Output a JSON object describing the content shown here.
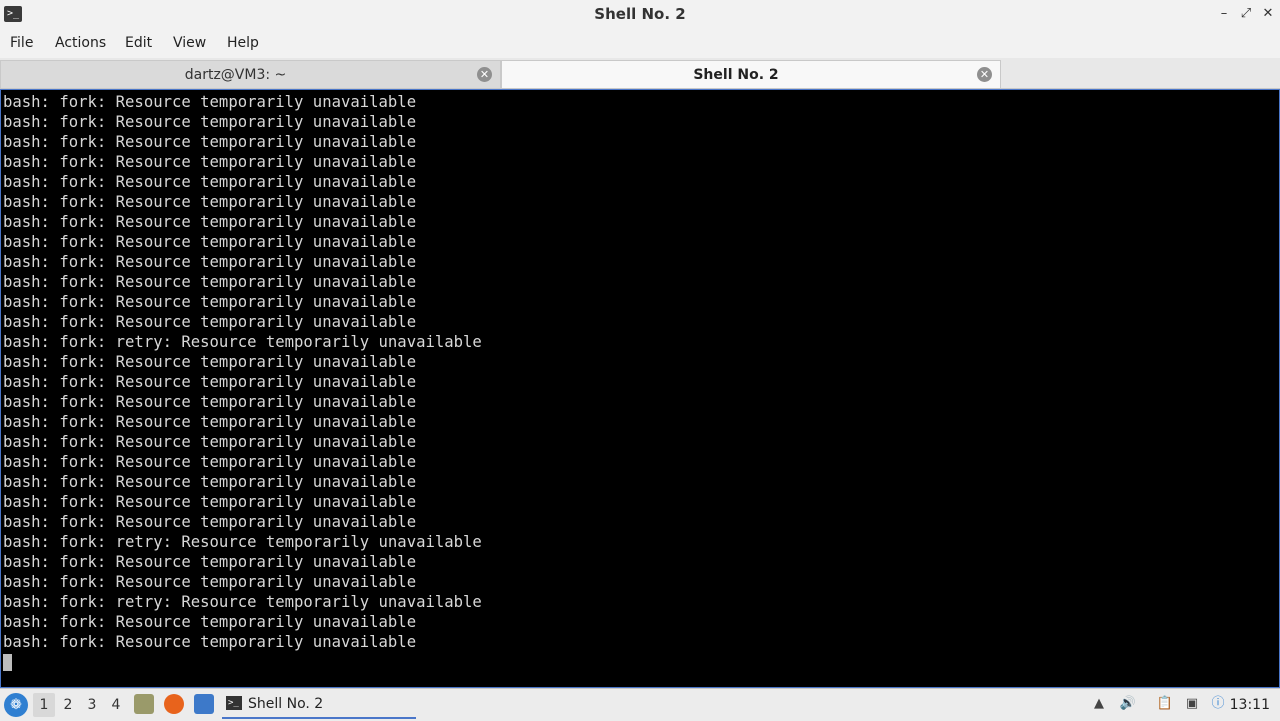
{
  "window": {
    "title": "Shell No. 2",
    "app_icon": "terminal-icon",
    "buttons": {
      "minimize": "minimize-icon",
      "maximize": "maximize-icon",
      "close": "close-icon"
    }
  },
  "menu": [
    "File",
    "Actions",
    "Edit",
    "View",
    "Help"
  ],
  "tabs": [
    {
      "label": "dartz@VM3: ~",
      "active": false
    },
    {
      "label": "Shell No. 2",
      "active": true
    }
  ],
  "terminal": {
    "lines": [
      "bash: fork: Resource temporarily unavailable",
      "bash: fork: Resource temporarily unavailable",
      "bash: fork: Resource temporarily unavailable",
      "bash: fork: Resource temporarily unavailable",
      "bash: fork: Resource temporarily unavailable",
      "bash: fork: Resource temporarily unavailable",
      "bash: fork: Resource temporarily unavailable",
      "bash: fork: Resource temporarily unavailable",
      "bash: fork: Resource temporarily unavailable",
      "bash: fork: Resource temporarily unavailable",
      "bash: fork: Resource temporarily unavailable",
      "bash: fork: Resource temporarily unavailable",
      "bash: fork: retry: Resource temporarily unavailable",
      "bash: fork: Resource temporarily unavailable",
      "bash: fork: Resource temporarily unavailable",
      "bash: fork: Resource temporarily unavailable",
      "bash: fork: Resource temporarily unavailable",
      "bash: fork: Resource temporarily unavailable",
      "bash: fork: Resource temporarily unavailable",
      "bash: fork: Resource temporarily unavailable",
      "bash: fork: Resource temporarily unavailable",
      "bash: fork: Resource temporarily unavailable",
      "bash: fork: retry: Resource temporarily unavailable",
      "bash: fork: Resource temporarily unavailable",
      "bash: fork: Resource temporarily unavailable",
      "bash: fork: retry: Resource temporarily unavailable",
      "bash: fork: Resource temporarily unavailable",
      "bash: fork: Resource temporarily unavailable"
    ]
  },
  "taskbar": {
    "workspaces": [
      "1",
      "2",
      "3",
      "4"
    ],
    "active_workspace": "1",
    "task_label": "Shell No. 2",
    "clock": "13:11"
  },
  "colors": {
    "terminal_bg": "#000000",
    "terminal_fg": "#d8d8d8",
    "accent": "#4a76c9"
  }
}
